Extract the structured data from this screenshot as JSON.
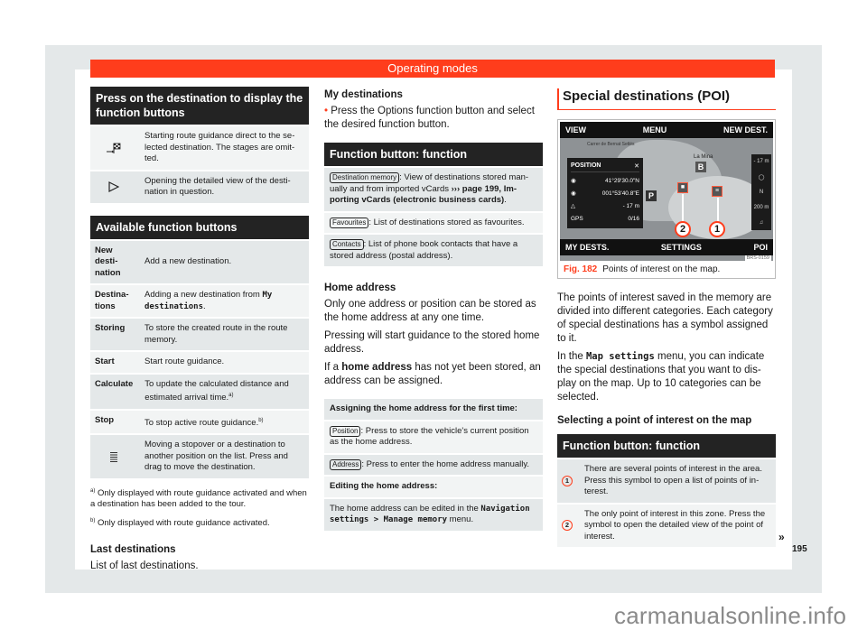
{
  "header": {
    "title": "Operating modes"
  },
  "left": {
    "table1": {
      "title": "Press on the destination to display the function buttons",
      "rows": [
        {
          "icon": "checkered-flag-arrow-icon",
          "text": "Starting route guidance direct to the se­lected destination. The stages are omit­ted."
        },
        {
          "icon": "play-triangle-icon",
          "text": "Opening the detailed view of the desti­nation in question."
        }
      ]
    },
    "table2": {
      "title": "Available function buttons",
      "rows": [
        {
          "label": "New desti­nation",
          "text": "Add a new destination."
        },
        {
          "label": "Destina­tions",
          "text": "Adding a new destination from ",
          "mono": "My destinations",
          "suffix": "."
        },
        {
          "label": "Storing",
          "text": "To store the created route in the route memory."
        },
        {
          "label": "Start",
          "text": "Start route guidance."
        },
        {
          "label": "Calculate",
          "text": "To update the calculated distance and estimated arrival time.",
          "sup": "a)"
        },
        {
          "label": "Stop",
          "text": "To stop active route guidance.",
          "sup": "b)"
        },
        {
          "icon": "drag-list-icon",
          "text": "Moving a stopover or a destination to another position on the list. Press and drag to move the destination."
        }
      ]
    },
    "footnotes": [
      {
        "mark": "a)",
        "text": "Only displayed with route guidance activated and when a destination has been added to the tour."
      },
      {
        "mark": "b)",
        "text": "Only displayed with route guidance activated."
      }
    ],
    "last_destinations": {
      "heading": "Last destinations",
      "text": "List of last destinations."
    }
  },
  "middle": {
    "my_destinations": {
      "heading": "My destinations",
      "bullet": "Press the Options function button and se­lect the desired function button."
    },
    "table": {
      "title": "Function button: function",
      "rows": [
        {
          "button": "Destination memory",
          "text": ": View of destinations stored man­ually and from imported vCards ",
          "link": "››› page 199, Im­porting vCards (electronic business cards)",
          "suffix": "."
        },
        {
          "button": "Favourites",
          "text": ": List of destinations stored as favourites."
        },
        {
          "button": "Contacts",
          "text": ": List of phone book contacts that have a stored address (postal address)."
        }
      ]
    },
    "home_address": {
      "heading": "Home address",
      "para1": "Only one address or position can be stored as the home address at any one time.",
      "para2": "Pressing will start guidance to the stored home address.",
      "para3_pre": "If a ",
      "para3_bold": "home address",
      "para3_post": " has not yet been stored, an address can be assigned."
    },
    "home_table": {
      "subhead1": "Assigning the home address for the first time:",
      "rows": [
        {
          "button": "Position",
          "text": ": Press to store the vehicle's current position as the home address."
        },
        {
          "button": "Address",
          "text": ": Press to enter the home address manually."
        }
      ],
      "subhead2": "Editing the home address:",
      "edit_pre": "The home address can be edited in the ",
      "edit_mono": "Naviga­tion settings > Manage memory",
      "edit_post": " menu."
    }
  },
  "right": {
    "section_title": "Special destinations (POI)",
    "figure": {
      "map": {
        "top_left": "VIEW",
        "top_center": "MENU",
        "top_right": "NEW DEST.",
        "bottom_left": "MY DESTS.",
        "bottom_center": "SETTINGS",
        "bottom_right": "POI",
        "street_label": "Carrer de Bernat Setlés",
        "place_label": "La Mina",
        "position_panel": {
          "title": "POSITION",
          "lat": "41°29'30.0\"N",
          "lon": "001°53'40.8\"E",
          "alt": "- 17 m",
          "gps": "0/16",
          "gps_label": "GPS"
        },
        "side_controls": [
          "- 17 m",
          "200 m"
        ],
        "callout1": "1",
        "callout2": "2",
        "code": "BRS-0159"
      },
      "caption_num": "Fig. 182",
      "caption_text": "Points of interest on the map."
    },
    "para1": "The points of interest saved in the memory are divided into different categories. Each category of special destinations has a sym­bol assigned to it.",
    "para2_pre": "In the ",
    "para2_mono": "Map settings",
    "para2_post": " menu, you can indicate the special destinations that you want to dis­play on the map. Up to 10 categories can be selected.",
    "sub_heading": "Selecting a point of interest on the map",
    "table": {
      "title": "Function button: function",
      "rows": [
        {
          "num": "1",
          "text": "There are several points of interest in the area. Press this symbol to open a list of points of in­terest."
        },
        {
          "num": "2",
          "text": "The only point of interest in this zone. Press the symbol to open the detailed view of the point of interest."
        }
      ]
    }
  },
  "continue_mark": "»",
  "page_number": "195",
  "watermark": "carmanualsonline.info"
}
